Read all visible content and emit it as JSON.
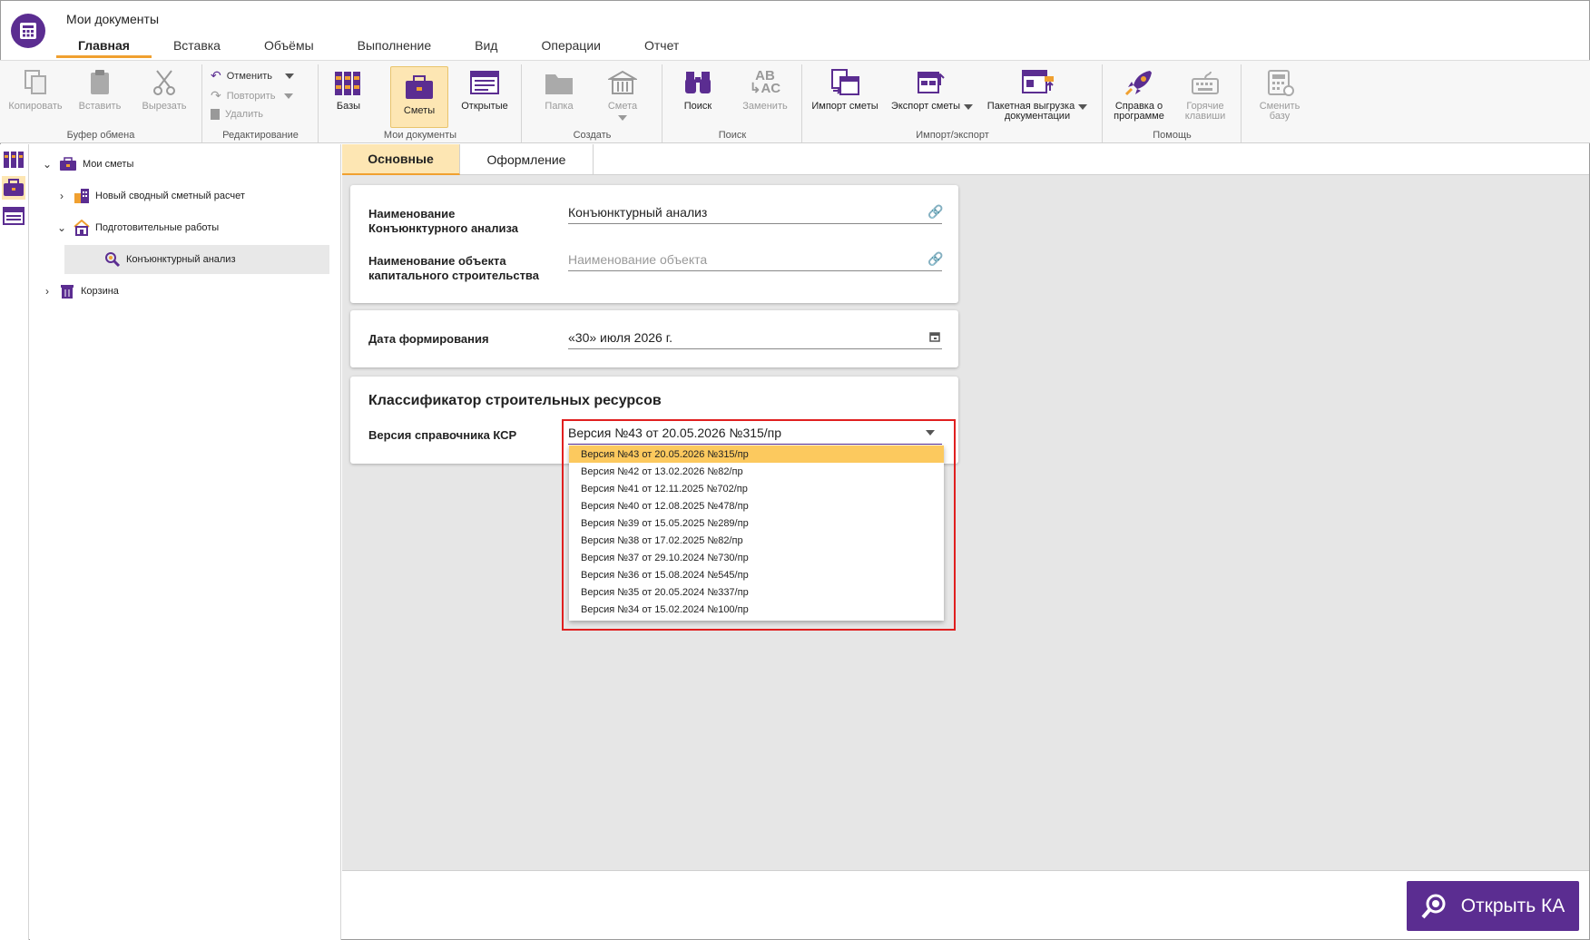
{
  "app": {
    "title": "Мои документы"
  },
  "tabs": [
    "Главная",
    "Вставка",
    "Объёмы",
    "Выполнение",
    "Вид",
    "Операции",
    "Отчет"
  ],
  "ribbon": {
    "clipboard": {
      "copy": "Копировать",
      "paste": "Вставить",
      "cut": "Вырезать",
      "label": "Буфер обмена"
    },
    "edit": {
      "undo": "Отменить",
      "redo": "Повторить",
      "delete": "Удалить",
      "label": "Редактирование"
    },
    "docs": {
      "bases": "Базы",
      "estimates": "Сметы",
      "open": "Открытые",
      "label": "Мои документы"
    },
    "create": {
      "folder": "Папка",
      "estimate": "Смета",
      "label": "Создать"
    },
    "search": {
      "search": "Поиск",
      "replace": "Заменить",
      "label": "Поиск"
    },
    "io": {
      "import": "Импорт сметы",
      "export": "Экспорт сметы",
      "batch1": "Пакетная выгрузка",
      "batch2": "документации",
      "label": "Импорт/экспорт"
    },
    "help": {
      "about1": "Справка о",
      "about2": "программе",
      "hotkeys1": "Горячие",
      "hotkeys2": "клавиши",
      "label": "Помощь"
    },
    "change": {
      "l1": "Сменить",
      "l2": "базу"
    }
  },
  "tree": {
    "root": "Мои сметы",
    "items": [
      "Новый сводный сметный расчет",
      "Подготовительные работы",
      "Конъюнктурный анализ",
      "Корзина"
    ]
  },
  "panel_tabs": [
    "Основные",
    "Оформление"
  ],
  "form": {
    "name_label_1": "Наименование",
    "name_label_2": "Конъюнктурного анализа",
    "name_value": "Конъюнктурный анализ",
    "obj_label_1": "Наименование объекта",
    "obj_label_2": "капитального строительства",
    "obj_placeholder": "Наименование объекта",
    "date_label": "Дата формирования",
    "date_value": "«30» июля 2026 г.",
    "ksr_title": "Классификатор строительных ресурсов",
    "ksr_label": "Версия справочника КСР",
    "ksr_value": "Версия №43 от 20.05.2026 №315/пр"
  },
  "versions": [
    "Версия №43 от 20.05.2026 №315/пр",
    "Версия №42 от 13.02.2026 №82/пр",
    "Версия №41 от 12.11.2025 №702/пр",
    "Версия №40 от 12.08.2025 №478/пр",
    "Версия №39 от 15.05.2025 №289/пр",
    "Версия №38 от 17.02.2025 №82/пр",
    "Версия №37 от 29.10.2024 №730/пр",
    "Версия №36 от 15.08.2024 №545/пр",
    "Версия №35 от 20.05.2024 №337/пр",
    "Версия №34 от 15.02.2024 №100/пр"
  ],
  "footer": {
    "open_button": "Открыть КА"
  },
  "colors": {
    "brand": "#5b2d91",
    "accent": "#f0a030",
    "selected_option": "#fcc95e",
    "highlight": "#e01f1f"
  }
}
